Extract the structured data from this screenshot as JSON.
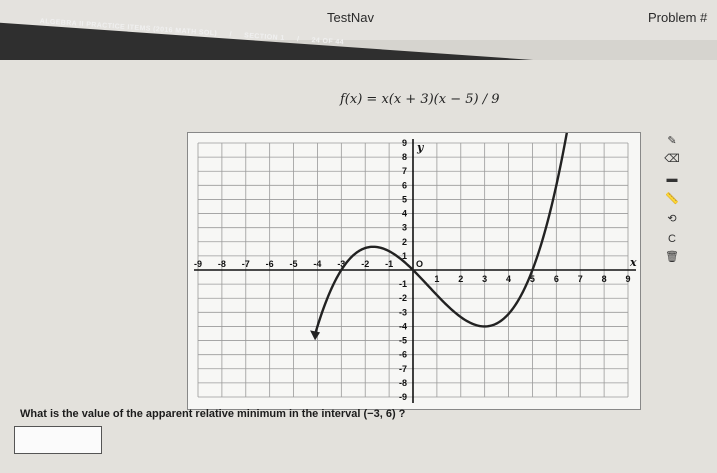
{
  "app_title": "TestNav",
  "problem_label": "Problem #",
  "breadcrumb": {
    "course": "ALGEBRA II PRACTICE ITEMS (2016 MATH SOL)",
    "sep": "/",
    "section": "SECTION 1",
    "sep2": "/",
    "progress": "24 OF 44"
  },
  "function_text": "f(x) = x(x + 3)(x − 5) / 9",
  "question_text": "What is the value of the apparent relative minimum in the interval (−3, 6) ?",
  "answer_value": "",
  "tools": [
    "pencil-icon",
    "eraser-icon",
    "highlight-icon",
    "ruler-icon",
    "rotate-icon",
    "reset-icon",
    "trash-icon"
  ],
  "graph": {
    "y_label": "y",
    "x_label": "x",
    "xlim": [
      -9,
      9
    ],
    "ylim": [
      -9,
      9
    ],
    "x_ticks": [
      "-9",
      "-8",
      "-7",
      "-6",
      "-5",
      "-4",
      "-3",
      "-2",
      "-1",
      "1",
      "2",
      "3",
      "4",
      "5",
      "6",
      "7",
      "8",
      "9"
    ],
    "y_ticks": [
      "9",
      "8",
      "7",
      "6",
      "5",
      "4",
      "3",
      "2",
      "1",
      "-1",
      "-2",
      "-3",
      "-4",
      "-5",
      "-6",
      "-7",
      "-8",
      "-9"
    ],
    "origin_label": "O",
    "curve_color": "#222222"
  }
}
